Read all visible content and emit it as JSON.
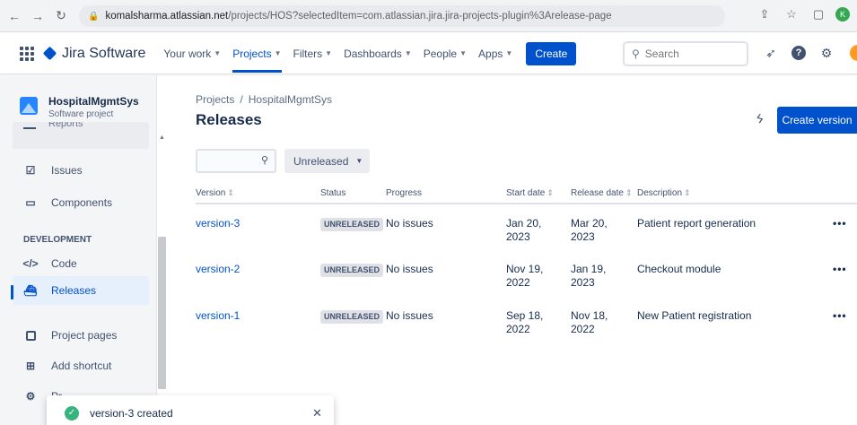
{
  "browser": {
    "url_host": "komalsharma.atlassian.net",
    "url_rest": "/projects/HOS?selectedItem=com.atlassian.jira.jira-projects-plugin%3Arelease-page",
    "profile_initial": "K"
  },
  "topnav": {
    "product": "Jira Software",
    "items": [
      {
        "label": "Your work"
      },
      {
        "label": "Projects"
      },
      {
        "label": "Filters"
      },
      {
        "label": "Dashboards"
      },
      {
        "label": "People"
      },
      {
        "label": "Apps"
      }
    ],
    "create_label": "Create",
    "search_placeholder": "Search",
    "help_glyph": "?"
  },
  "sidebar": {
    "project_name": "HospitalMgmtSys",
    "project_type": "Software project",
    "partial_item": "Reports",
    "items": [
      {
        "label": "Issues"
      },
      {
        "label": "Components"
      },
      {
        "label": "Code"
      },
      {
        "label": "Releases"
      },
      {
        "label": "Project pages"
      },
      {
        "label": "Add shortcut"
      },
      {
        "label": "Pr"
      }
    ],
    "section_development": "DEVELOPMENT"
  },
  "main": {
    "breadcrumb": [
      "Projects",
      "HospitalMgmtSys"
    ],
    "title": "Releases",
    "create_version_label": "Create version",
    "status_filter": "Unreleased",
    "columns": [
      "Version",
      "Status",
      "Progress",
      "Start date",
      "Release date",
      "Description"
    ],
    "rows": [
      {
        "version": "version-3",
        "status": "UNRELEASED",
        "progress": "No issues",
        "start": "Jan 20, 2023",
        "release": "Mar 20, 2023",
        "description": "Patient report generation"
      },
      {
        "version": "version-2",
        "status": "UNRELEASED",
        "progress": "No issues",
        "start": "Nov 19, 2022",
        "release": "Jan 19, 2023",
        "description": "Checkout module"
      },
      {
        "version": "version-1",
        "status": "UNRELEASED",
        "progress": "No issues",
        "start": "Sep 18, 2022",
        "release": "Nov 18, 2022",
        "description": "New Patient registration"
      }
    ]
  },
  "toast": {
    "message": "version-3 created"
  }
}
